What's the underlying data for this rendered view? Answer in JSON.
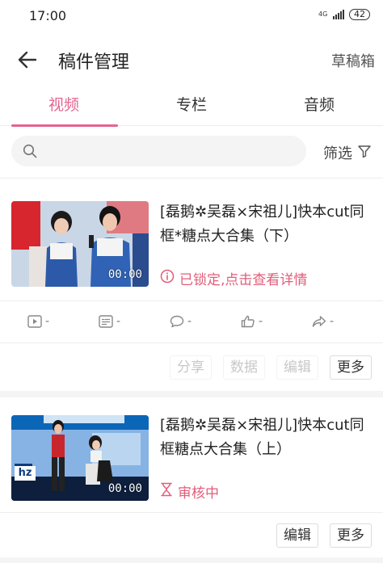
{
  "status_bar": {
    "time": "17:00",
    "network": "4G",
    "battery": "42"
  },
  "header": {
    "title": "稿件管理",
    "drafts_label": "草稿箱"
  },
  "tabs": [
    {
      "label": "视频",
      "active": true
    },
    {
      "label": "专栏",
      "active": false
    },
    {
      "label": "音频",
      "active": false
    }
  ],
  "filter": {
    "search_placeholder": "",
    "filter_label": "筛选"
  },
  "videos": [
    {
      "title": "[磊鹅✲吴磊×宋祖儿]快本cut同框*糖点大合集（下）",
      "duration": "00:00",
      "status": "已锁定,点击查看详情",
      "status_icon": "info-circle-icon",
      "stats": {
        "plays": "-",
        "danmaku": "-",
        "comments": "-",
        "likes": "-",
        "shares": "-"
      },
      "actions": {
        "share": "分享",
        "data": "数据",
        "edit": "编辑",
        "more": "更多"
      }
    },
    {
      "title": "[磊鹅✲吴磊×宋祖儿]快本cut同框糖点大合集（上）",
      "duration": "00:00",
      "status": "审核中",
      "status_icon": "hourglass-icon",
      "thumb_caption": "hz",
      "actions": {
        "edit": "编辑",
        "more": "更多"
      }
    }
  ],
  "colors": {
    "accent": "#e4648f",
    "status": "#e25d7a"
  }
}
